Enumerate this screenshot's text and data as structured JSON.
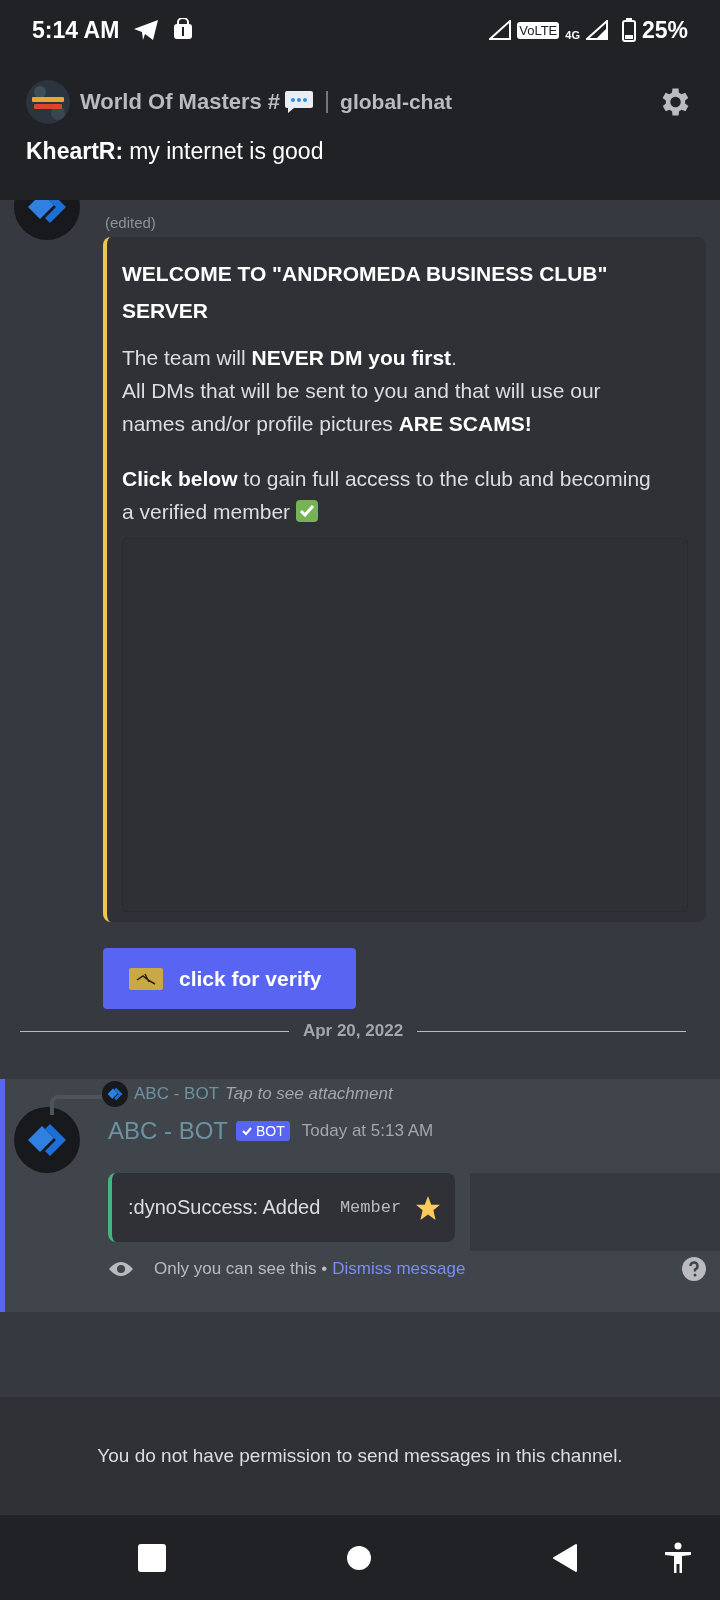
{
  "status_bar": {
    "time": "5:14 AM",
    "volte": "VoLTE",
    "network": "4G",
    "battery": "25%"
  },
  "header": {
    "server": "World Of Masters #",
    "channel": "global-chat",
    "preview_author": "KheartR:",
    "preview_text": "my internet is good"
  },
  "messages": [
    {
      "kind": "announcement",
      "edited": "(edited)",
      "embed": {
        "color": "#e9c84b",
        "title": "WELCOME TO \"ANDROMEDA BUSINESS CLUB\" SERVER",
        "paragraphs": [
          "The team will **NEVER DM you first**.\nAll DMs that will be sent to you and that will use our names and/or profile pictures **ARE SCAMS!**",
          "**Click below** to gain full access to the club and becoming          a verified member"
        ]
      },
      "button": "click for verify"
    },
    {
      "kind": "divider",
      "label": "Apr 20, 2022"
    },
    {
      "kind": "ephemeral",
      "reply": {
        "author": "ABC - BOT",
        "text": "Tap to see attachment"
      },
      "author": "ABC - BOT",
      "badge": "BOT",
      "timestamp": "Today at 5:13 AM",
      "embed": {
        "color": "#43b581",
        "text": ":dynoSuccess: Added ",
        "code": "Member"
      },
      "notice": "Only you can see this •",
      "link": "Dismiss message"
    }
  ],
  "footer": "You do not have permission to send messages in this channel."
}
